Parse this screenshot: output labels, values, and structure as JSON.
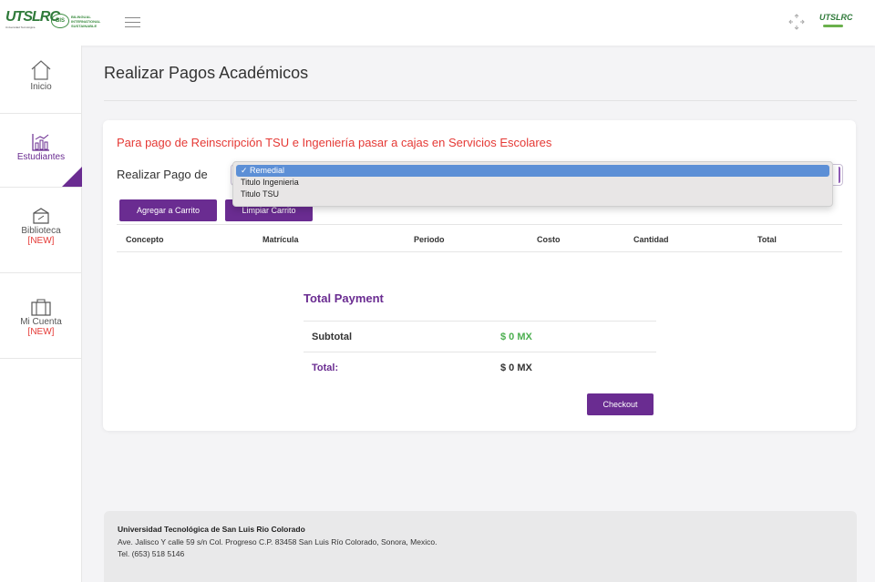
{
  "header": {
    "logo_text": "UTSLRC",
    "logo_subtext": "Universidad Tecnológica",
    "bis_text": "BIS",
    "bis_caption": "BILINGUAL INTERNATIONAL SUSTAINABLE",
    "user_logo_text": "UTSLRC"
  },
  "sidebar": {
    "items": [
      {
        "label": "Inicio",
        "badge": ""
      },
      {
        "label": "Estudiantes",
        "badge": ""
      },
      {
        "label": "Biblioteca",
        "badge": "[NEW]"
      },
      {
        "label": "Mi Cuenta",
        "badge": "[NEW]"
      }
    ],
    "active_color": "#6a2c91"
  },
  "main": {
    "title": "Realizar Pagos Académicos",
    "notice": "Para pago de Reinscripción TSU e Ingeniería pasar a cajas en Servicios Escolares",
    "select_label": "Realizar Pago de",
    "select_options": [
      "✓ Remedial",
      "Titulo Ingenieria",
      "Titulo TSU"
    ],
    "selected_option": "Remedial",
    "add_button": "Agregar a Carrito",
    "clear_button": "Limpiar Carrito",
    "table_headers": [
      "Concepto",
      "Matrícula",
      "Periodo",
      "Costo",
      "Cantidad",
      "Total"
    ],
    "table_rows": []
  },
  "payment": {
    "title": "Total Payment",
    "subtotal_label": "Subtotal",
    "subtotal_value": "$ 0 MX",
    "total_label": "Total:",
    "total_value": "$ 0 MX",
    "checkout_button": "Checkout"
  },
  "footer": {
    "university": "Universidad Tecnológica de San Luis Rio Colorado",
    "address": "Ave. Jalisco Y calle 59 s/n Col. Progreso C.P. 83458 San Luis Río Colorado, Sonora, Mexico.",
    "phone": "Tel. (653) 518 5146"
  },
  "colors": {
    "primary": "#6a2c91",
    "alert": "#e53935",
    "success": "#4caf50",
    "select_highlight": "#5c8fd6"
  },
  "icons": [
    "menu-icon",
    "expand-icon",
    "home-icon",
    "chart-icon",
    "book-icon",
    "briefcase-icon",
    "checkmark-icon"
  ]
}
